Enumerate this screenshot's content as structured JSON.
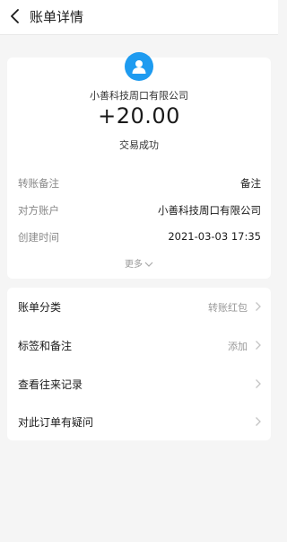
{
  "header": {
    "title": "账单详情"
  },
  "transaction": {
    "merchant": "小善科技周口有限公司",
    "amount": "+20.00",
    "status": "交易成功",
    "details": [
      {
        "label": "转账备注",
        "value": "备注"
      },
      {
        "label": "对方账户",
        "value": "小善科技周口有限公司"
      },
      {
        "label": "创建时间",
        "value": "2021-03-03 17:35"
      }
    ],
    "more_label": "更多"
  },
  "menu": [
    {
      "label": "账单分类",
      "value": "转账红包"
    },
    {
      "label": "标签和备注",
      "value": "添加"
    },
    {
      "label": "查看往来记录",
      "value": ""
    },
    {
      "label": "对此订单有疑问",
      "value": ""
    }
  ],
  "colors": {
    "background": "#f5f5f5",
    "card": "#ffffff",
    "avatar": "#1e9bf0",
    "muted_text": "#888888",
    "primary_text": "#1a1a1a"
  },
  "icons": {
    "back": "chevron-left-icon",
    "avatar": "user-avatar-icon",
    "more": "chevron-down-icon",
    "row": "chevron-right-icon"
  }
}
